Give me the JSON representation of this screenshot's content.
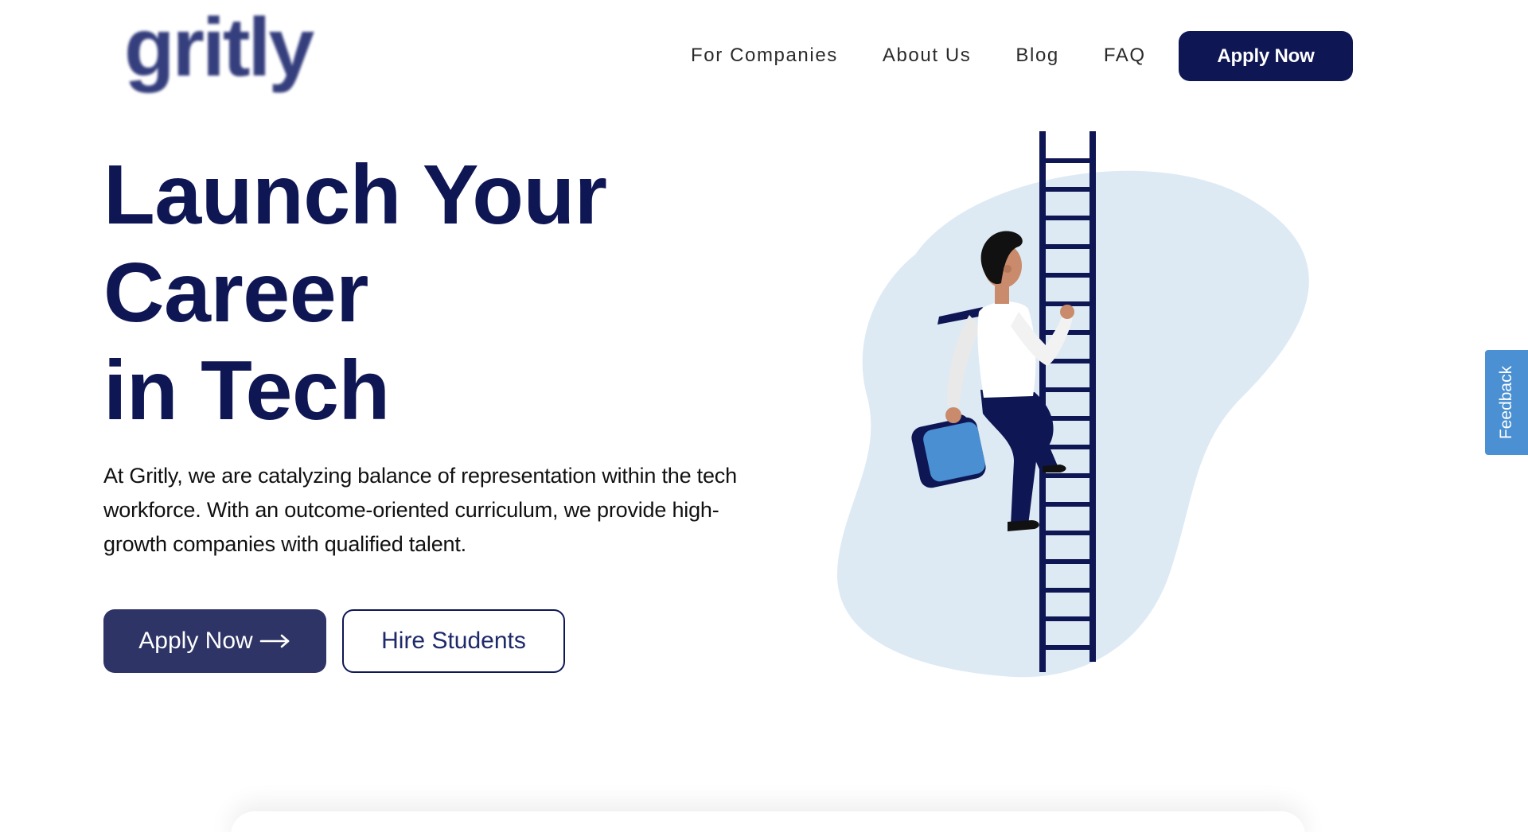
{
  "colors": {
    "brand_navy": "#0f1654",
    "logo_navy": "#2b3577",
    "nav_text": "#2a2a2a",
    "cta_primary_bg": "#2e3466",
    "cta_secondary_text": "#1f2a6b",
    "blob": "#ddeaf4",
    "feedback_bg": "#4a90d2",
    "briefcase": "#4a8fd1"
  },
  "header": {
    "logo_text": "gritly",
    "nav": [
      {
        "label": "For Companies"
      },
      {
        "label": "About Us"
      },
      {
        "label": "Blog"
      },
      {
        "label": "FAQ"
      }
    ],
    "apply_button_label": "Apply Now"
  },
  "hero": {
    "title_lines": [
      "Launch Your",
      "Career",
      "in Tech"
    ],
    "description": "At Gritly, we are catalyzing balance of representation within the tech workforce. With an outcome-oriented curriculum, we provide high-growth companies with qualified talent.",
    "primary_cta_label": "Apply Now",
    "secondary_cta_label": "Hire Students"
  },
  "feedback": {
    "label": "Feedback"
  }
}
